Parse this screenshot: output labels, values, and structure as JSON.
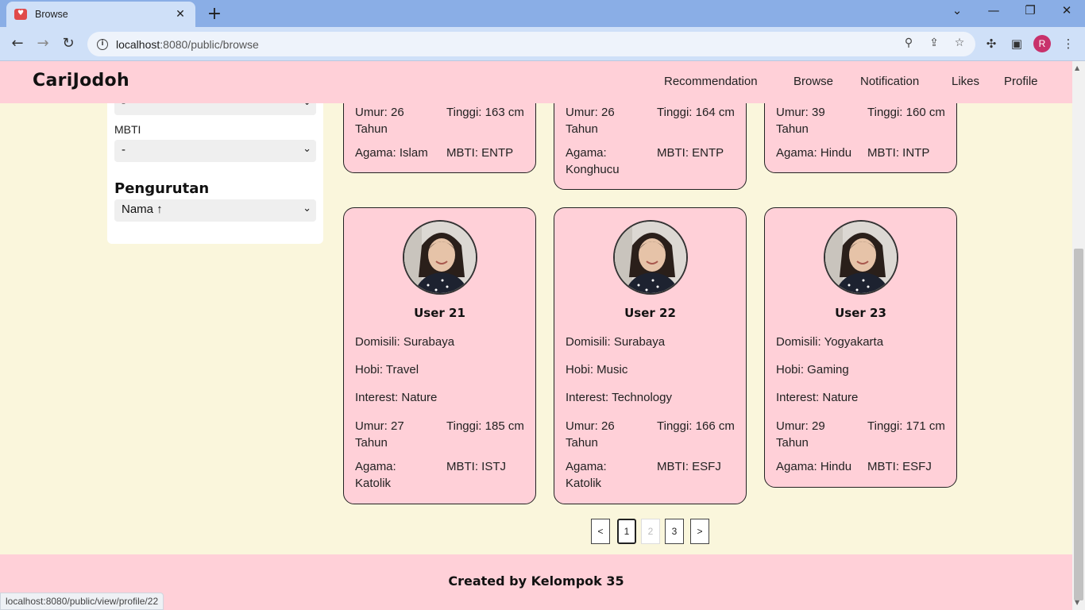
{
  "browser": {
    "tab_title": "Browse",
    "url_host": "localhost",
    "url_path": ":8080/public/browse",
    "status_url": "localhost:8080/public/view/profile/22",
    "profile_initial": "R"
  },
  "site": {
    "logo": "CariJodoh",
    "nav": [
      "Recommendation",
      "Browse",
      "Notification",
      "Likes",
      "Profile"
    ]
  },
  "filters": {
    "prev_select_value": "-",
    "mbti_label": "MBTI",
    "mbti_value": "-",
    "sort_heading": "Pengurutan",
    "sort_value": "Nama ↑"
  },
  "top_cards": [
    {
      "umur": "Umur: 26",
      "tahun": "Tahun",
      "tinggi": "Tinggi: 163 cm",
      "agama": "Agama: Islam",
      "agama2": "",
      "mbti": "MBTI: ENTP"
    },
    {
      "umur": "Umur: 26",
      "tahun": "Tahun",
      "tinggi": "Tinggi: 164 cm",
      "agama": "Agama:",
      "agama2": "Konghucu",
      "mbti": "MBTI: ENTP"
    },
    {
      "umur": "Umur: 39",
      "tahun": "Tahun",
      "tinggi": "Tinggi: 160 cm",
      "agama": "Agama: Hindu",
      "agama2": "",
      "mbti": "MBTI: INTP"
    }
  ],
  "cards": [
    {
      "name": "User 21",
      "domisili": "Domisili: Surabaya",
      "hobi": "Hobi: Travel",
      "interest": "Interest: Nature",
      "umur": "Umur: 27",
      "tahun": "Tahun",
      "tinggi": "Tinggi: 185 cm",
      "agama": "Agama:",
      "agama2": "Katolik",
      "mbti": "MBTI: ISTJ"
    },
    {
      "name": "User 22",
      "domisili": "Domisili: Surabaya",
      "hobi": "Hobi: Music",
      "interest": "Interest: Technology",
      "umur": "Umur: 26",
      "tahun": "Tahun",
      "tinggi": "Tinggi: 166 cm",
      "agama": "Agama:",
      "agama2": "Katolik",
      "mbti": "MBTI: ESFJ"
    },
    {
      "name": "User 23",
      "domisili": "Domisili: Yogyakarta",
      "hobi": "Hobi: Gaming",
      "interest": "Interest: Nature",
      "umur": "Umur: 29",
      "tahun": "Tahun",
      "tinggi": "Tinggi: 171 cm",
      "agama": "Agama: Hindu",
      "agama2": "",
      "mbti": "MBTI: ESFJ"
    }
  ],
  "pagination": {
    "prev": "<",
    "pages": [
      "1",
      "2",
      "3"
    ],
    "next": ">"
  },
  "footer": {
    "text": "Created by Kelompok 35"
  }
}
